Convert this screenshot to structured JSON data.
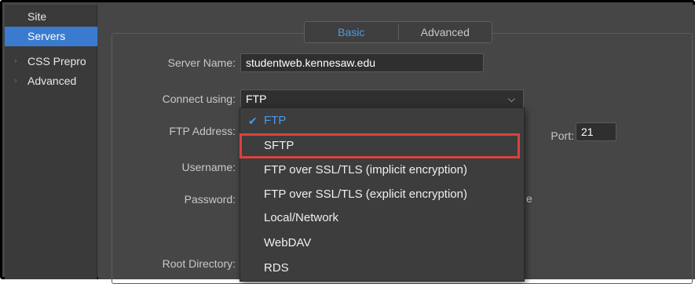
{
  "sidebar": {
    "items": [
      {
        "label": "Site"
      },
      {
        "label": "Servers"
      },
      {
        "label": "CSS Prepro"
      },
      {
        "label": "Advanced"
      }
    ]
  },
  "tabs": [
    {
      "label": "Basic"
    },
    {
      "label": "Advanced"
    }
  ],
  "form": {
    "server_name_label": "Server Name:",
    "server_name_value": "studentweb.kennesaw.edu",
    "connect_label": "Connect using:",
    "connect_value": "FTP",
    "ftp_address_label": "FTP Address:",
    "port_label": "Port:",
    "port_value": "21",
    "username_label": "Username:",
    "password_label": "Password:",
    "save_partial": "e",
    "root_dir_label": "Root Directory:"
  },
  "dropdown": {
    "options": [
      {
        "label": "FTP"
      },
      {
        "label": "SFTP"
      },
      {
        "label": "FTP over SSL/TLS (implicit encryption)"
      },
      {
        "label": "FTP over SSL/TLS (explicit encryption)"
      },
      {
        "label": "Local/Network"
      },
      {
        "label": "WebDAV"
      },
      {
        "label": "RDS"
      }
    ],
    "checked_index": 0,
    "highlighted_index": 1
  },
  "colors": {
    "accent": "#3b7bcf",
    "highlight": "#d9413f"
  }
}
